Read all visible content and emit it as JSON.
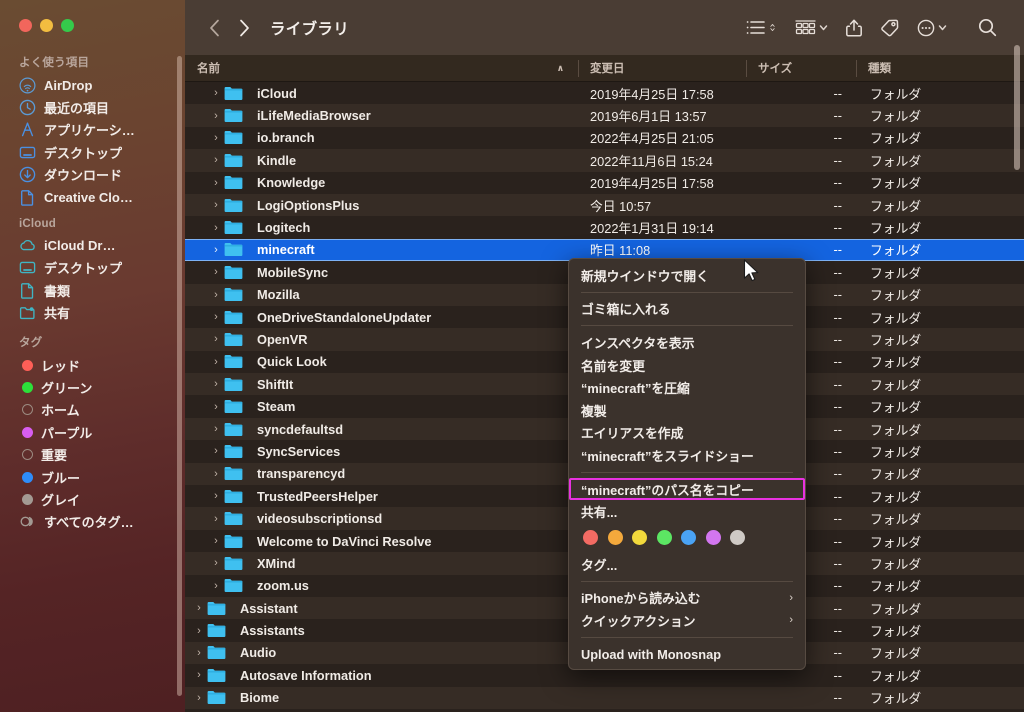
{
  "window": {
    "title": "ライブラリ",
    "traffic_lights": [
      {
        "name": "close",
        "color": "#f2665c"
      },
      {
        "name": "minimize",
        "color": "#f2bd40"
      },
      {
        "name": "zoom",
        "color": "#35ca4b"
      }
    ]
  },
  "toolbar": {
    "back_label": "‹",
    "forward_label": "›",
    "icons": [
      {
        "name": "list-view-icon",
        "label": "表示方法"
      },
      {
        "name": "group-by-icon",
        "label": "グループ"
      },
      {
        "name": "share-icon",
        "label": "共有"
      },
      {
        "name": "tag-icon",
        "label": "タグ"
      },
      {
        "name": "more-actions-icon",
        "label": "その他"
      },
      {
        "name": "search-icon",
        "label": "検索"
      }
    ]
  },
  "sidebar": {
    "sections": [
      {
        "title": "よく使う項目",
        "items": [
          {
            "label": "AirDrop",
            "icon": "airdrop-icon",
            "color": "#5b9bd5"
          },
          {
            "label": "最近の項目",
            "icon": "clock-icon",
            "color": "#5b9bd5"
          },
          {
            "label": "アプリケーシ…",
            "icon": "applications-icon",
            "color": "#4a90e2"
          },
          {
            "label": "デスクトップ",
            "icon": "desktop-icon",
            "color": "#4a90e2"
          },
          {
            "label": "ダウンロード",
            "icon": "download-icon",
            "color": "#4a90e2"
          },
          {
            "label": "Creative Clo…",
            "icon": "document-icon",
            "color": "#4a90e2"
          }
        ]
      },
      {
        "title": "iCloud",
        "items": [
          {
            "label": "iCloud Dr…",
            "icon": "cloud-icon",
            "color": "#3fb5c4"
          },
          {
            "label": "デスクトップ",
            "icon": "desktop-icon",
            "color": "#3fb5c4"
          },
          {
            "label": "書類",
            "icon": "document-icon",
            "color": "#3fb5c4"
          },
          {
            "label": "共有",
            "icon": "shared-folder-icon",
            "color": "#3fb5c4"
          }
        ]
      },
      {
        "title": "タグ",
        "items": [
          {
            "label": "レッド",
            "icon": "tag-dot-icon",
            "color": "#ff5f57"
          },
          {
            "label": "グリーン",
            "icon": "tag-dot-icon",
            "color": "#2ce03a"
          },
          {
            "label": "ホーム",
            "icon": "tag-dot-hollow-icon",
            "color": "hollow"
          },
          {
            "label": "パープル",
            "icon": "tag-dot-icon",
            "color": "#d85ef0"
          },
          {
            "label": "重要",
            "icon": "tag-dot-hollow-icon",
            "color": "hollow"
          },
          {
            "label": "ブルー",
            "icon": "tag-dot-icon",
            "color": "#2e8dfa"
          },
          {
            "label": "グレイ",
            "icon": "tag-dot-icon",
            "color": "#a39a93"
          },
          {
            "label": "すべてのタグ…",
            "icon": "all-tags-icon",
            "color": "#a39a93"
          }
        ]
      }
    ]
  },
  "file_list": {
    "columns": [
      {
        "key": "name",
        "label": "名前",
        "sorted": "asc",
        "sort_glyph": "∧"
      },
      {
        "key": "date",
        "label": "変更日"
      },
      {
        "key": "size",
        "label": "サイズ"
      },
      {
        "key": "kind",
        "label": "種類"
      }
    ],
    "rows": [
      {
        "name": "iCloud",
        "date": "2019年4月25日 17:58",
        "size": "--",
        "kind": "フォルダ",
        "indent": 1,
        "selected": false
      },
      {
        "name": "iLifeMediaBrowser",
        "date": "2019年6月1日 13:57",
        "size": "--",
        "kind": "フォルダ",
        "indent": 1,
        "selected": false
      },
      {
        "name": "io.branch",
        "date": "2022年4月25日 21:05",
        "size": "--",
        "kind": "フォルダ",
        "indent": 1,
        "selected": false
      },
      {
        "name": "Kindle",
        "date": "2022年11月6日 15:24",
        "size": "--",
        "kind": "フォルダ",
        "indent": 1,
        "selected": false
      },
      {
        "name": "Knowledge",
        "date": "2019年4月25日 17:58",
        "size": "--",
        "kind": "フォルダ",
        "indent": 1,
        "selected": false
      },
      {
        "name": "LogiOptionsPlus",
        "date": "今日 10:57",
        "size": "--",
        "kind": "フォルダ",
        "indent": 1,
        "selected": false
      },
      {
        "name": "Logitech",
        "date": "2022年1月31日 19:14",
        "size": "--",
        "kind": "フォルダ",
        "indent": 1,
        "selected": false
      },
      {
        "name": "minecraft",
        "date": "昨日 11:08",
        "size": "--",
        "kind": "フォルダ",
        "indent": 1,
        "selected": true
      },
      {
        "name": "MobileSync",
        "date": "",
        "size": "--",
        "kind": "フォルダ",
        "indent": 1,
        "selected": false
      },
      {
        "name": "Mozilla",
        "date": "",
        "size": "--",
        "kind": "フォルダ",
        "indent": 1,
        "selected": false
      },
      {
        "name": "OneDriveStandaloneUpdater",
        "date": "",
        "size": "--",
        "kind": "フォルダ",
        "indent": 1,
        "selected": false
      },
      {
        "name": "OpenVR",
        "date": "",
        "size": "--",
        "kind": "フォルダ",
        "indent": 1,
        "selected": false
      },
      {
        "name": "Quick Look",
        "date": "",
        "size": "--",
        "kind": "フォルダ",
        "indent": 1,
        "selected": false
      },
      {
        "name": "ShiftIt",
        "date": "",
        "size": "--",
        "kind": "フォルダ",
        "indent": 1,
        "selected": false
      },
      {
        "name": "Steam",
        "date": "",
        "size": "--",
        "kind": "フォルダ",
        "indent": 1,
        "selected": false
      },
      {
        "name": "syncdefaultsd",
        "date": "",
        "size": "--",
        "kind": "フォルダ",
        "indent": 1,
        "selected": false
      },
      {
        "name": "SyncServices",
        "date": "",
        "size": "--",
        "kind": "フォルダ",
        "indent": 1,
        "selected": false
      },
      {
        "name": "transparencyd",
        "date": "",
        "size": "--",
        "kind": "フォルダ",
        "indent": 1,
        "selected": false
      },
      {
        "name": "TrustedPeersHelper",
        "date": "",
        "size": "--",
        "kind": "フォルダ",
        "indent": 1,
        "selected": false
      },
      {
        "name": "videosubscriptionsd",
        "date": "",
        "size": "--",
        "kind": "フォルダ",
        "indent": 1,
        "selected": false
      },
      {
        "name": "Welcome to DaVinci Resolve",
        "date": "",
        "size": "--",
        "kind": "フォルダ",
        "indent": 1,
        "selected": false
      },
      {
        "name": "XMind",
        "date": "",
        "size": "--",
        "kind": "フォルダ",
        "indent": 1,
        "selected": false
      },
      {
        "name": "zoom.us",
        "date": "",
        "size": "--",
        "kind": "フォルダ",
        "indent": 1,
        "selected": false
      },
      {
        "name": "Assistant",
        "date": "",
        "size": "--",
        "kind": "フォルダ",
        "indent": 0,
        "selected": false
      },
      {
        "name": "Assistants",
        "date": "",
        "size": "--",
        "kind": "フォルダ",
        "indent": 0,
        "selected": false
      },
      {
        "name": "Audio",
        "date": "",
        "size": "--",
        "kind": "フォルダ",
        "indent": 0,
        "selected": false
      },
      {
        "name": "Autosave Information",
        "date": "",
        "size": "--",
        "kind": "フォルダ",
        "indent": 0,
        "selected": false
      },
      {
        "name": "Biome",
        "date": "",
        "size": "--",
        "kind": "フォルダ",
        "indent": 0,
        "selected": false
      }
    ]
  },
  "context_menu": {
    "items": [
      {
        "label": "新規ウインドウで開く",
        "type": "item"
      },
      {
        "type": "separator"
      },
      {
        "label": "ゴミ箱に入れる",
        "type": "item"
      },
      {
        "type": "separator"
      },
      {
        "label": "インスペクタを表示",
        "type": "item"
      },
      {
        "label": "名前を変更",
        "type": "item"
      },
      {
        "label": "“minecraft”を圧縮",
        "type": "item"
      },
      {
        "label": "複製",
        "type": "item"
      },
      {
        "label": "エイリアスを作成",
        "type": "item"
      },
      {
        "label": "“minecraft”をスライドショー",
        "type": "item"
      },
      {
        "type": "separator"
      },
      {
        "label": "“minecraft”のパス名をコピー",
        "type": "item",
        "highlighted": true
      },
      {
        "label": "共有...",
        "type": "item"
      },
      {
        "type": "colors"
      },
      {
        "label": "タグ...",
        "type": "item"
      },
      {
        "type": "separator"
      },
      {
        "label": "iPhoneから読み込む",
        "type": "item",
        "submenu": "›"
      },
      {
        "label": "クイックアクション",
        "type": "item",
        "submenu": "›"
      },
      {
        "type": "separator"
      },
      {
        "label": "Upload with Monosnap",
        "type": "item"
      }
    ],
    "tag_colors": [
      "#f36b63",
      "#f4a93c",
      "#f2d93c",
      "#5ce663",
      "#4aa3f5",
      "#d276f0",
      "#cfcac5"
    ],
    "highlight_color": "#e832e0"
  }
}
